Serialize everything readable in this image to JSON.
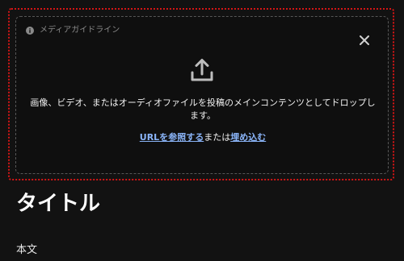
{
  "media": {
    "guidelines_label": "メディアガイドライン",
    "instruction": "画像、ビデオ、またはオーディオファイルを投稿のメインコンテンツとしてドロップします。",
    "browse_url_link": "URLを参照する",
    "or_text": "または",
    "embed_link": "埋め込む"
  },
  "post": {
    "title_placeholder": "タイトル",
    "body_placeholder": "本文"
  },
  "icons": {
    "info": "info-icon",
    "close": "close-icon",
    "upload": "upload-icon"
  },
  "colors": {
    "background": "#121212",
    "link": "#8ab4f8",
    "focus_outline": "#d41515",
    "dropzone_border": "#575757"
  }
}
